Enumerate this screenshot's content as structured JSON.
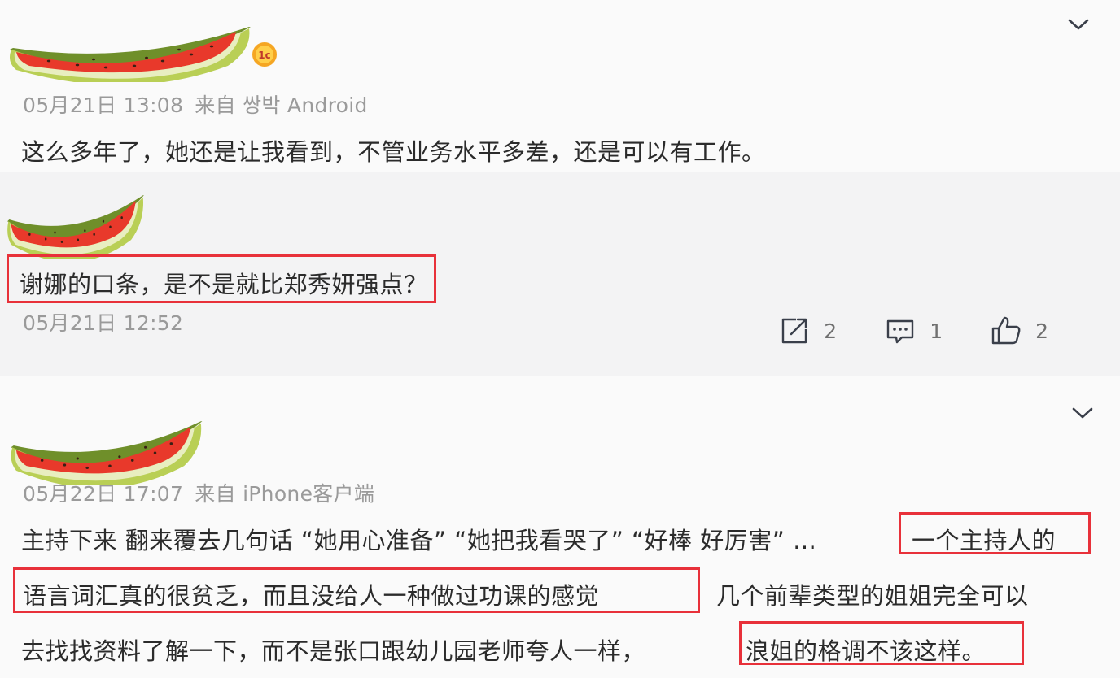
{
  "comments": [
    {
      "meta": {
        "date": "05月21日 13:08",
        "source": "来自 쌍박 Android"
      },
      "text": "这么多年了，她还是让我看到，不管业务水平多差，还是可以有工作。",
      "has_badge": true
    },
    {
      "meta": {
        "date": "05月21日 12:52"
      },
      "text": "谢娜的口条，是不是就比郑秀妍强点？",
      "actions": {
        "share_count": "2",
        "comment_count": "1",
        "like_count": "2"
      }
    },
    {
      "meta": {
        "date": "05月22日 17:07",
        "source": "来自 iPhone客户端"
      },
      "lines": [
        {
          "plain": "主持下来 翻来覆去几句话 “她用心准备” “她把我看哭了” “好棒 好厉害” …",
          "highlight": "一个主持人的"
        },
        {
          "highlight": "语言词汇真的很贫乏，而且没给人一种做过功课的感觉",
          "plain": "几个前辈类型的姐姐完全可以"
        },
        {
          "plain": "去找找资料了解一下，而不是张口跟幼儿园老师夸人一样，",
          "highlight": "浪姐的格调不该这样。"
        }
      ]
    }
  ],
  "icons": {
    "avatar": "watermelon-slice-avatar",
    "badge": "vip-badge-icon",
    "menu": "chevron-down-icon",
    "share": "share-icon",
    "comment": "comment-icon",
    "like": "thumbs-up-icon"
  },
  "colors": {
    "highlight_border": "#e8313a",
    "meta_text": "#9a9a9a",
    "body_text": "#2b2b2b",
    "highlight_bg": "#f3f3f4"
  }
}
